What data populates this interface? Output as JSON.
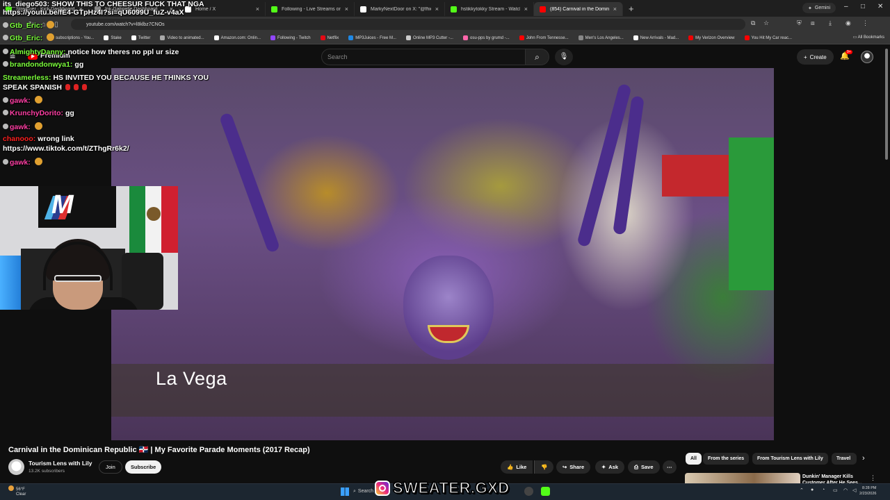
{
  "browser": {
    "tabs": [
      {
        "label": "Streamer · Kick Dashboard",
        "color": "#53fc18"
      },
      {
        "label": "Ink Gabrielle Dashboard",
        "color": "#888888"
      },
      {
        "label": "Home / X",
        "color": "#ffffff"
      },
      {
        "label": "Following - Live Streams on Ki",
        "color": "#53fc18"
      },
      {
        "label": "MarkyNextDoor on X: \"@fhion",
        "color": "#ffffff"
      },
      {
        "label": "hstikkytokky Stream - Watch Li",
        "color": "#53fc18"
      },
      {
        "label": "(854) Carnival in the Domin",
        "color": "#ff0000"
      }
    ],
    "new_tab": "+",
    "gemini_label": "Gemini",
    "window_controls": [
      "–",
      "□",
      "✕"
    ],
    "url": "youtube.com/watch?v=l8klbz7CNOs",
    "bookmarks": [
      {
        "label": "subscriptions - You...",
        "color": "#ff0000"
      },
      {
        "label": "Stake",
        "color": "#ffffff"
      },
      {
        "label": "Twitter",
        "color": "#ffffff"
      },
      {
        "label": "Video to animated...",
        "color": "#aaaaaa"
      },
      {
        "label": "Amazon.com: Onlin...",
        "color": "#ffffff"
      },
      {
        "label": "Following - Twitch",
        "color": "#9146ff"
      },
      {
        "label": "Netflix",
        "color": "#e50914"
      },
      {
        "label": "MP3Juices - Free M...",
        "color": "#1e88e5"
      },
      {
        "label": "Online MP3 Cutter -...",
        "color": "#cccccc"
      },
      {
        "label": "osu-pps by grumd -...",
        "color": "#ff66aa"
      },
      {
        "label": "John From Tennesse...",
        "color": "#ff0000"
      },
      {
        "label": "Men's Los Angeles...",
        "color": "#888888"
      },
      {
        "label": "New Arrivals - Mad...",
        "color": "#ffffff"
      },
      {
        "label": "My Verizon Overview",
        "color": "#ee0000"
      },
      {
        "label": "You Hit My Car reac...",
        "color": "#ff0000"
      }
    ],
    "all_bookmarks": "All Bookmarks"
  },
  "youtube": {
    "logo_text": "Premium",
    "search_placeholder": "Search",
    "create_label": "Create",
    "notif_count": "9+",
    "video": {
      "caption": "La Vega"
    },
    "title": "Carnival in the Dominican Republic 🇩🇴 | My Favorite Parade Moments (2017 Recap)",
    "channel_name": "Tourism Lens with Lily",
    "subscribers": "13.2K subscribers",
    "join_label": "Join",
    "subscribe_label": "Subscribe",
    "actions": {
      "like": "Like",
      "share": "Share",
      "ask": "Ask",
      "save": "Save"
    },
    "chips": [
      "All",
      "From the series",
      "From Tourism Lens with Lily",
      "Travel"
    ],
    "rec_title": "Dunkin' Manager Kills Customer After He Sees..."
  },
  "stream_overlay": {
    "chat": [
      {
        "user": "its_diego503:",
        "color": "#ffffff",
        "msg": "SHOW THIS TO CHEESUR FUCK THAT NGA",
        "badge": false,
        "emote": ""
      },
      {
        "user": "",
        "color": "#ffffff",
        "msg": "https://youtu.be/fE4-GTpHz4I?si=qU6099U_fuZ-v4aX",
        "badge": false,
        "emote": ""
      },
      {
        "user": "Gtb_Eric:",
        "color": "#7cff3c",
        "msg": "",
        "badge": true,
        "emote": "face"
      },
      {
        "user": "Gtb_Eric:",
        "color": "#7cff3c",
        "msg": "",
        "badge": true,
        "emote": "face"
      },
      {
        "user": "AlmightyDanny:",
        "color": "#7cff3c",
        "msg": "notice how theres no ppl ur size",
        "badge": true,
        "emote": ""
      },
      {
        "user": "brandondonwya1:",
        "color": "#7cff3c",
        "msg": "gg",
        "badge": true,
        "emote": ""
      },
      {
        "user": "Streamerless:",
        "color": "#7cff3c",
        "msg": "HS INVITED YOU BECAUSE HE THINKS YOU",
        "badge": false,
        "emote": ""
      },
      {
        "user": "",
        "color": "#ffffff",
        "msg": "SPEAK SPANISH",
        "badge": false,
        "emote": "red"
      },
      {
        "user": "gawk:",
        "color": "#ff3fa4",
        "msg": "",
        "badge": true,
        "emote": "face"
      },
      {
        "user": "KrunchyDorito:",
        "color": "#ff3fa4",
        "msg": "gg",
        "badge": true,
        "emote": ""
      },
      {
        "user": "gawk:",
        "color": "#ff3fa4",
        "msg": "",
        "badge": true,
        "emote": "face"
      },
      {
        "user": "chanooo:",
        "color": "#ff2020",
        "msg": "wrong link",
        "badge": false,
        "emote": ""
      },
      {
        "user": "",
        "color": "#ffffff",
        "msg": "https://www.tiktok.com/t/ZThgRr6k2/",
        "badge": false,
        "emote": ""
      },
      {
        "user": "gawk:",
        "color": "#ff3fa4",
        "msg": "",
        "badge": true,
        "emote": "face"
      }
    ],
    "watermark": "SWEATER.GXD"
  },
  "taskbar": {
    "weather_temp": "56°F",
    "weather_desc": "Clear",
    "search_label": "Search",
    "time": "8:28 PM",
    "date": "2/23/2026"
  }
}
